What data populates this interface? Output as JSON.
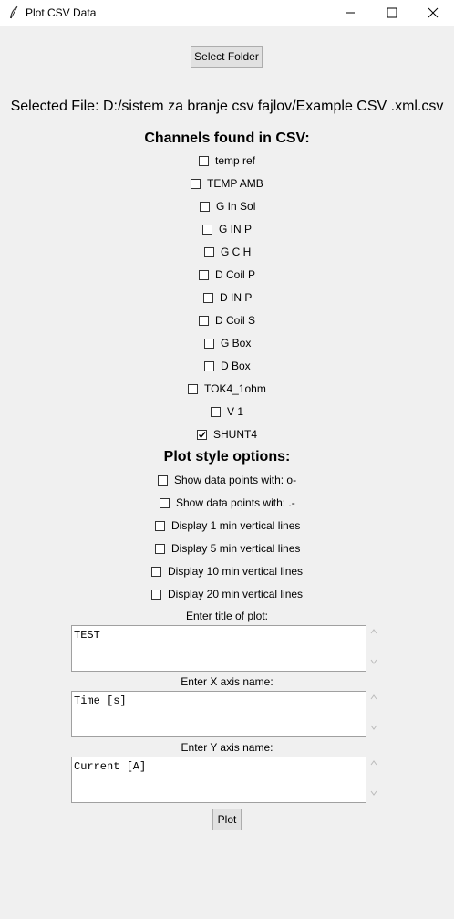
{
  "window": {
    "title": "Plot CSV Data"
  },
  "buttons": {
    "select_folder": "Select Folder",
    "plot": "Plot"
  },
  "selected_file": "Selected File: D:/sistem za branje csv fajlov/Example CSV .xml.csv",
  "channels_heading": "Channels found in CSV:",
  "channels": [
    {
      "label": "temp ref",
      "checked": false
    },
    {
      "label": "TEMP AMB",
      "checked": false
    },
    {
      "label": "G In Sol",
      "checked": false
    },
    {
      "label": "G IN P",
      "checked": false
    },
    {
      "label": "G C H",
      "checked": false
    },
    {
      "label": "D Coil P",
      "checked": false
    },
    {
      "label": "D IN P",
      "checked": false
    },
    {
      "label": "D Coil S",
      "checked": false
    },
    {
      "label": "G Box",
      "checked": false
    },
    {
      "label": "D Box",
      "checked": false
    },
    {
      "label": "TOK4_1ohm",
      "checked": false
    },
    {
      "label": "V 1",
      "checked": false
    },
    {
      "label": "SHUNT4",
      "checked": true
    }
  ],
  "style_heading": "Plot style options:",
  "style_options": [
    {
      "label": "Show data points with: o-",
      "checked": false
    },
    {
      "label": "Show data points with: .-",
      "checked": false
    },
    {
      "label": "Display 1 min vertical lines",
      "checked": false
    },
    {
      "label": "Display 5 min vertical lines",
      "checked": false
    },
    {
      "label": "Display 10 min vertical lines",
      "checked": false
    },
    {
      "label": "Display 20 min vertical lines",
      "checked": false
    }
  ],
  "title_field": {
    "label": "Enter title of plot:",
    "value": "TEST"
  },
  "x_field": {
    "label": "Enter X axis name:",
    "value": "Time [s]"
  },
  "y_field": {
    "label": "Enter Y axis name:",
    "value": "Current [A]"
  }
}
